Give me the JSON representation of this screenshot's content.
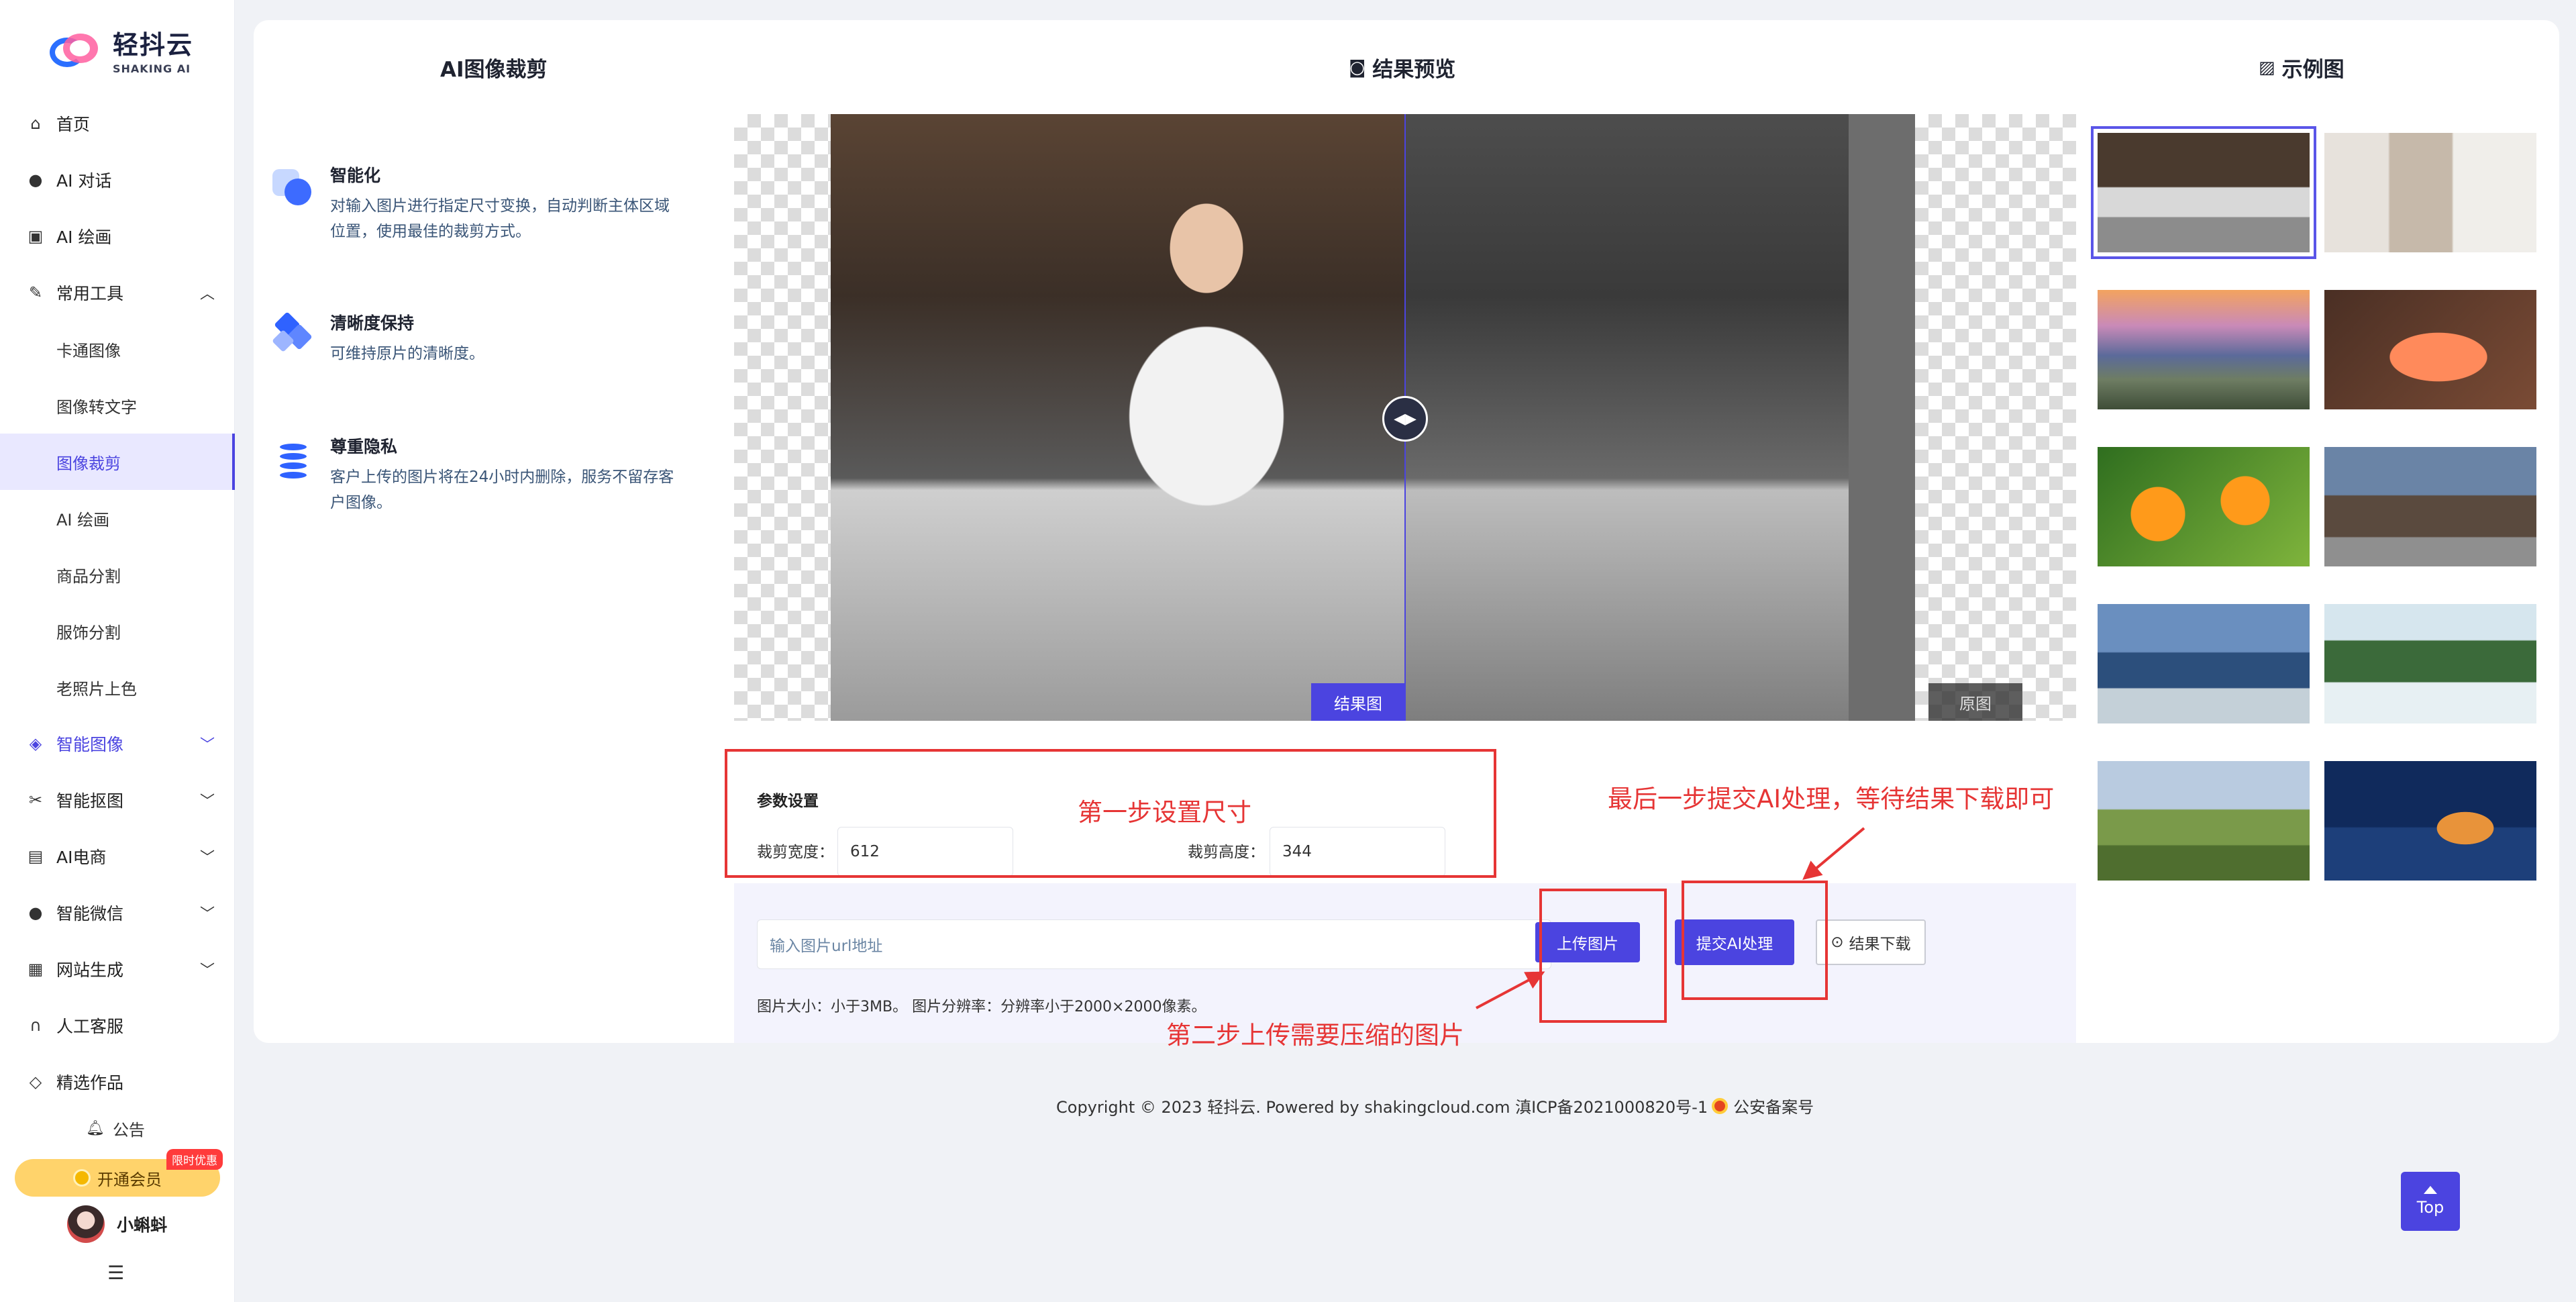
{
  "brand": {
    "name": "轻抖云",
    "subtitle": "SHAKING AI"
  },
  "sidebar": {
    "items": [
      {
        "label": "首页",
        "icon": "home-icon"
      },
      {
        "label": "AI 对话",
        "icon": "chat-icon"
      },
      {
        "label": "AI 绘画",
        "icon": "image-icon"
      },
      {
        "label": "常用工具",
        "icon": "wrench-icon",
        "expanded": true
      },
      {
        "label": "卡通图像"
      },
      {
        "label": "图像转文字"
      },
      {
        "label": "图像裁剪",
        "active": true
      },
      {
        "label": "AI 绘画"
      },
      {
        "label": "商品分割"
      },
      {
        "label": "服饰分割"
      },
      {
        "label": "老照片上色"
      },
      {
        "label": "智能图像",
        "icon": "target-icon"
      },
      {
        "label": "智能抠图",
        "icon": "scissors-icon"
      },
      {
        "label": "AI电商",
        "icon": "shop-icon"
      },
      {
        "label": "智能微信",
        "icon": "wechat-icon"
      },
      {
        "label": "网站生成",
        "icon": "web-icon"
      },
      {
        "label": "人工客服",
        "icon": "headset-icon"
      },
      {
        "label": "精选作品",
        "icon": "diamond-icon"
      }
    ],
    "notice": "公告",
    "vip": {
      "label": "开通会员",
      "badge": "限时优惠"
    },
    "user": {
      "name": "小蝌蚪"
    }
  },
  "left_panel": {
    "title": "AI图像裁剪",
    "features": [
      {
        "title": "智能化",
        "desc_line1": "对输入图片进行指定尺寸变换，自动判断主体区域",
        "desc_line2": "位置，使用最佳的裁剪方式。"
      },
      {
        "title": "清晰度保持",
        "desc_line1": "可维持原片的清晰度。",
        "desc_line2": ""
      },
      {
        "title": "尊重隐私",
        "desc_line1": "客户上传的图片将在24小时内删除，服务不留存客",
        "desc_line2": "户图像。"
      }
    ]
  },
  "preview": {
    "title": "结果预览",
    "tag_result": "结果图",
    "tag_original": "原图"
  },
  "params": {
    "title": "参数设置",
    "width_label": "裁剪宽度：",
    "width_value": "612",
    "height_label": "裁剪高度：",
    "height_value": "344"
  },
  "upload": {
    "url_placeholder": "输入图片url地址",
    "upload_button": "上传图片",
    "submit_button": "提交AI处理",
    "download_button": "结果下载",
    "hint": "图片大小：小于3MB。 图片分辨率：分辨率小于2000×2000像素。"
  },
  "examples": {
    "title": "示例图"
  },
  "annotations": {
    "step1": "第一步设置尺寸",
    "step2": "第二步上传需要压缩的图片",
    "step3": "最后一步提交AI处理，等待结果下载即可"
  },
  "footer": {
    "text": "Copyright © 2023 轻抖云. Powered by shakingcloud.com 滇ICP备2021000820号-1",
    "police": "公安备案号"
  },
  "top_button": "Top",
  "colors": {
    "accent": "#4b44e0",
    "annotation": "#e63535"
  }
}
